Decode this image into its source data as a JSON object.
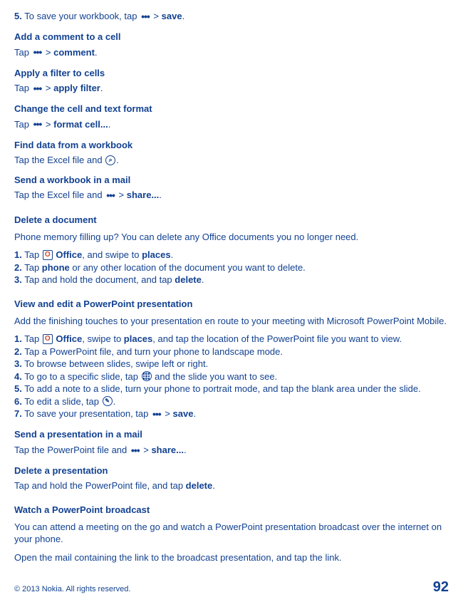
{
  "save_workbook": {
    "num": "5.",
    "text1": " To save your workbook, tap ",
    "gt": " > ",
    "save": "save",
    "end": "."
  },
  "add_comment": {
    "title": "Add a comment to a cell",
    "tap": "Tap ",
    "gt": " > ",
    "label": "comment",
    "end": "."
  },
  "apply_filter": {
    "title": "Apply a filter to cells",
    "tap": "Tap ",
    "gt": " > ",
    "label": "apply filter",
    "end": "."
  },
  "format_cell": {
    "title": "Change the cell and text format",
    "tap": "Tap ",
    "gt": " > ",
    "label": "format cell...",
    "end": "."
  },
  "find_data": {
    "title": "Find data from a workbook",
    "line": "Tap the Excel file and ",
    "end": "."
  },
  "send_workbook": {
    "title": "Send a workbook in a mail",
    "line": "Tap the Excel file and ",
    "gt": " > ",
    "label": "share...",
    "end": "."
  },
  "delete_doc": {
    "title": "Delete a document",
    "intro": "Phone memory filling up? You can delete any Office documents you no longer need.",
    "s1n": "1.",
    "s1a": " Tap ",
    "s1b": " Office",
    "s1c": ", and swipe to ",
    "s1d": "places",
    "s1e": ".",
    "s2n": "2.",
    "s2a": " Tap ",
    "s2b": "phone",
    "s2c": " or any other location of the document you want to delete.",
    "s3n": "3.",
    "s3a": " Tap and hold the document, and tap ",
    "s3b": "delete",
    "s3c": "."
  },
  "view_ppt": {
    "title": "View and edit a PowerPoint presentation",
    "intro": "Add the finishing touches to your presentation en route to your meeting with Microsoft PowerPoint Mobile.",
    "s1n": "1.",
    "s1a": " Tap ",
    "s1b": " Office",
    "s1c": ", swipe to ",
    "s1d": "places",
    "s1e": ", and tap the location of the PowerPoint file you want to view.",
    "s2n": "2.",
    "s2": " Tap a PowerPoint file, and turn your phone to landscape mode.",
    "s3n": "3.",
    "s3": " To browse between slides, swipe left or right.",
    "s4n": "4.",
    "s4a": " To go to a specific slide, tap ",
    "s4b": " and the slide you want to see.",
    "s5n": "5.",
    "s5": " To add a note to a slide, turn your phone to portrait mode, and tap the blank area under the slide.",
    "s6n": "6.",
    "s6a": " To edit a slide, tap ",
    "s6b": ".",
    "s7n": "7.",
    "s7a": " To save your presentation, tap ",
    "s7gt": " > ",
    "s7b": "save",
    "s7c": "."
  },
  "send_ppt": {
    "title": "Send a presentation in a mail",
    "line": "Tap the PowerPoint file and ",
    "gt": " > ",
    "label": "share...",
    "end": "."
  },
  "delete_ppt": {
    "title": "Delete a presentation",
    "line": "Tap and hold the PowerPoint file, and tap ",
    "label": "delete",
    "end": "."
  },
  "watch_broadcast": {
    "title": "Watch a PowerPoint broadcast",
    "p1": "You can attend a meeting on the go and watch a PowerPoint presentation broadcast over the internet on your phone.",
    "p2": "Open the mail containing the link to the broadcast presentation, and tap the link."
  },
  "footer": {
    "copyright": "© 2013 Nokia. All rights reserved.",
    "page": "92"
  }
}
